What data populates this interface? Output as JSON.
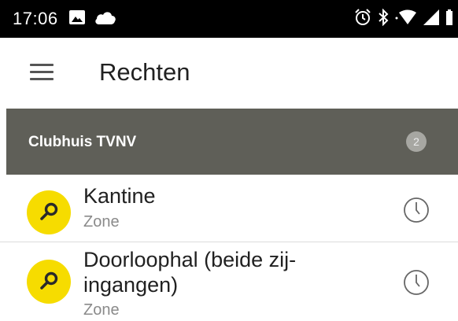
{
  "status_bar": {
    "time": "17:06",
    "icons_left": [
      "image-icon",
      "cloud-icon"
    ],
    "icons_right": [
      "alarm-icon",
      "bluetooth-icon",
      "wifi-icon",
      "signal-icon",
      "battery-icon"
    ]
  },
  "app_bar": {
    "title": "Rechten",
    "menu_icon": "hamburger-menu-icon"
  },
  "group": {
    "title": "Clubhuis TVNV",
    "count": "2"
  },
  "items": [
    {
      "title": "Kantine",
      "subtitle": "Zone",
      "icon": "key-icon",
      "action_icon": "clock-icon"
    },
    {
      "title": "Doorloophal (beide zij-ingangen)",
      "subtitle": "Zone",
      "icon": "key-icon",
      "action_icon": "clock-icon"
    }
  ],
  "colors": {
    "status_bar_bg": "#000000",
    "group_header_bg": "#5f5f58",
    "accent_yellow": "#f6dc00",
    "badge_bg": "#a7a7a2"
  }
}
